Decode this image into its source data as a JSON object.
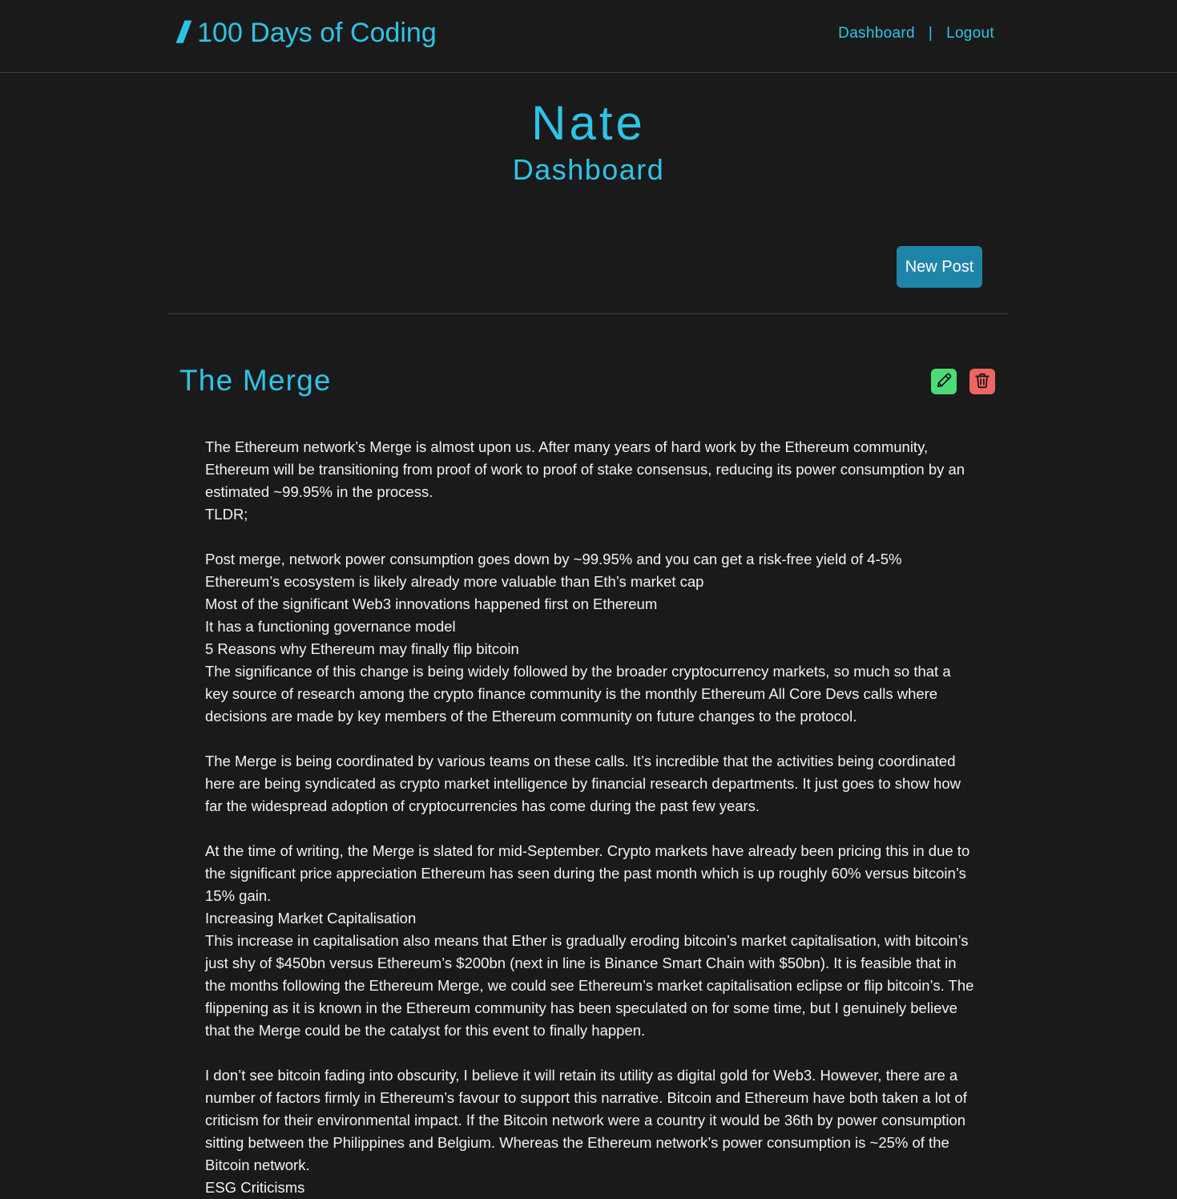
{
  "brand": {
    "mark": "//",
    "title": "100 Days of Coding"
  },
  "nav": {
    "dashboard": "Dashboard",
    "separator": "|",
    "logout": "Logout"
  },
  "header": {
    "username": "Nate",
    "page_title": "Dashboard"
  },
  "actions": {
    "new_post": "New Post"
  },
  "post": {
    "title": "The Merge",
    "edit_icon": "pencil-icon",
    "delete_icon": "trash-icon",
    "paragraphs": [
      "The Ethereum network’s Merge is almost upon us. After many years of hard work by the Ethereum community, Ethereum will be transitioning from proof of work to proof of stake consensus, reducing its power consumption by an estimated ~99.95% in the process.",
      "TLDR;",
      "",
      "Post merge, network power consumption goes down by ~99.95% and you can get a risk-free yield of 4-5%",
      "Ethereum’s ecosystem is likely already more valuable than Eth’s market cap",
      "Most of the significant Web3 innovations happened first on Ethereum",
      "It has a functioning governance model",
      "5 Reasons why Ethereum may finally flip bitcoin",
      "The significance of this change is being widely followed by the broader cryptocurrency markets, so much so that a key source of research among the crypto finance community is the monthly Ethereum All Core Devs calls where decisions are made by key members of the Ethereum community on future changes to the protocol.",
      "",
      "The Merge is being coordinated by various teams on these calls. It’s incredible that the activities being coordinated here are being syndicated as crypto market intelligence by financial research departments. It just goes to show how far the widespread adoption of cryptocurrencies has come during the past few years.",
      "",
      "At the time of writing, the Merge is slated for mid-September. Crypto markets have already been pricing this in due to the significant price appreciation Ethereum has seen during the past month which is up roughly 60% versus bitcoin’s 15% gain.",
      "Increasing Market Capitalisation",
      "This increase in capitalisation also means that Ether is gradually eroding bitcoin’s market capitalisation, with bitcoin’s just shy of $450bn versus Ethereum’s $200bn (next in line is Binance Smart Chain with $50bn). It is feasible that in the months following the Ethereum Merge, we could see Ethereum’s market capitalisation eclipse or flip bitcoin’s. The flippening as it is known in the Ethereum community has been speculated on for some time, but I genuinely believe that the Merge could be the catalyst for this event to finally happen.",
      "",
      "I don’t see bitcoin fading into obscurity, I believe it will retain its utility as digital gold for Web3. However, there are a number of factors firmly in Ethereum’s favour to support this narrative. Bitcoin and Ethereum have both taken a lot of criticism for their environmental impact. If the Bitcoin network were a country it would be 36th by power consumption sitting between the Philippines and Belgium. Whereas the Ethereum network’s power consumption is ~25% of the Bitcoin network.",
      "ESG Criticisms"
    ]
  },
  "colors": {
    "background": "#1a1a1a",
    "accent": "#2ec4e6",
    "new_post_button": "#1f85a8",
    "edit_button": "#4ddb78",
    "delete_button": "#ef6464"
  }
}
